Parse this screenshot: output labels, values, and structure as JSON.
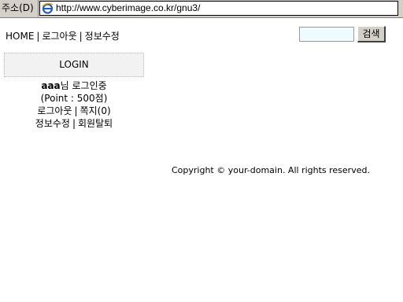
{
  "browser": {
    "address_label": "주소(D)",
    "url": "http://www.cyberimage.co.kr/gnu3/"
  },
  "topnav": {
    "home": "HOME",
    "logout": "로그아웃",
    "edit_info": "정보수정",
    "separator": "|"
  },
  "search": {
    "value": "",
    "button_label": "검색"
  },
  "login_box": {
    "title": "LOGIN"
  },
  "user": {
    "name": "aaa",
    "suffix": "님 로그인중",
    "points": "(Point : 500점)",
    "logout": "로그아웃",
    "memo": "쪽지(0)",
    "edit_info": "정보수정",
    "withdraw": "회원탈퇴",
    "separator": "|"
  },
  "footer": {
    "copyright": "Copyright © your-domain. All rights reserved."
  },
  "colors": {
    "chrome": "#d4d0c8",
    "search_input_bg": "#eefcff",
    "login_box_bg": "#f2f2f2"
  }
}
